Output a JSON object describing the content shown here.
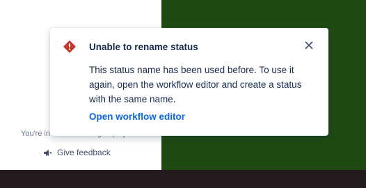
{
  "background": {
    "info_text": "You're in a team-managed project",
    "feedback_label": "Give feedback",
    "feedback_icon": "megaphone-icon"
  },
  "flag": {
    "icon": "error-icon",
    "title": "Unable to rename status",
    "body_lines": [
      "This status name has been used before. To use it",
      "again, open the workflow editor and create a status",
      "with the same name."
    ],
    "action_label": "Open workflow editor",
    "close_icon": "close-icon"
  },
  "colors": {
    "error": "#c9372c",
    "link": "#0c66e4",
    "text": "#172b4d",
    "right_panel": "#1f4a12",
    "bottom_strip": "#241a20"
  }
}
